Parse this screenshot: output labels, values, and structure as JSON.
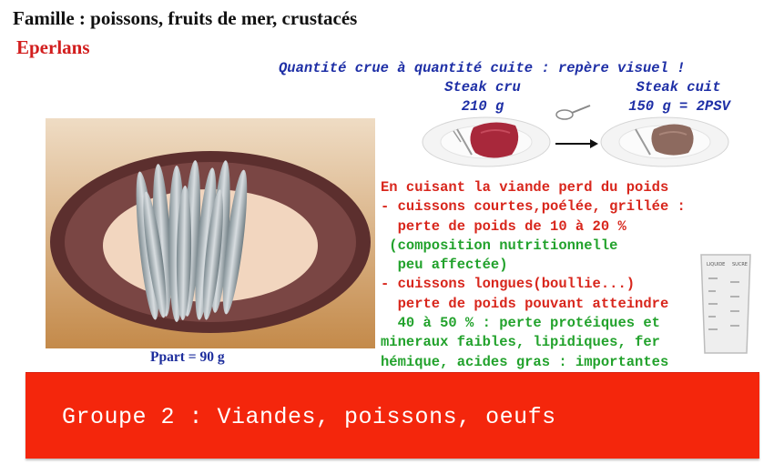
{
  "header": {
    "family": "Famille : poissons, fruits de mer, crustacés",
    "species": "Eperlans"
  },
  "visual_guide": {
    "title": "Quantité crue à quantité cuite : repère visuel !",
    "raw_label": "Steak cru",
    "raw_weight": "210 g",
    "cooked_label": "Steak cuit",
    "cooked_weight": "150 g = 2PSV"
  },
  "portion": {
    "label": "Ppart = 90 g"
  },
  "cooking_notes": {
    "line1": "En cuisant la viande perd du poids",
    "line2": "- cuissons courtes,poélée, grillée :",
    "line3": "  perte de poids de 10 à 20 %",
    "line4": " (composition nutritionnelle",
    "line5": "  peu affectée)",
    "line6": "- cuissons longues(boullie...)",
    "line7": "  perte de poids pouvant atteindre",
    "line8": "  40 à 50 % : perte protéiques et",
    "line9": "mineraux faibles, lipidiques, fer",
    "line10": "hémique, acides gras : importantes"
  },
  "group_banner": {
    "label": "Groupe 2 : Viandes, poissons, oeufs"
  },
  "beaker": {
    "label_left": "LIQUIDE",
    "label_right": "SUCRE"
  },
  "colors": {
    "title_blue": "#1e2fa6",
    "note_red": "#d8261c",
    "note_green": "#22a22c",
    "banner_red": "#f4260c",
    "species_red": "#d21e1e"
  }
}
